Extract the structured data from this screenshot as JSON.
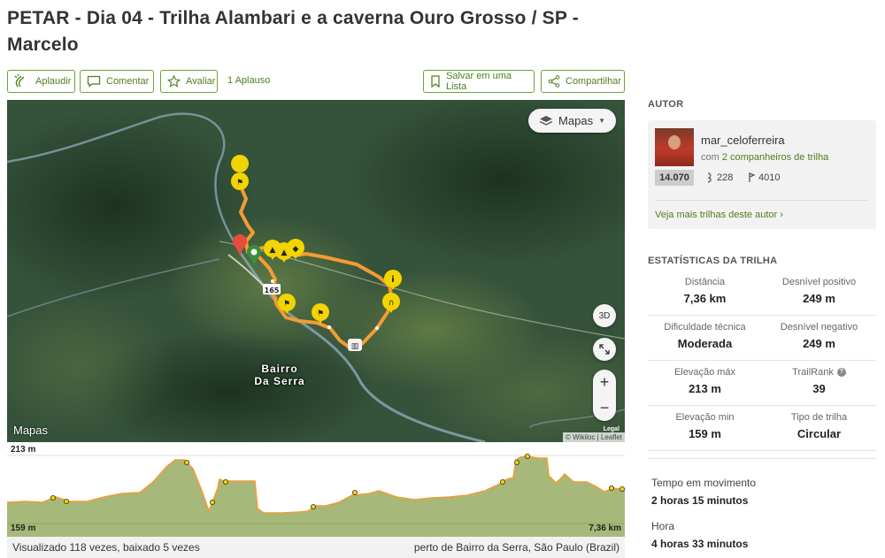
{
  "title": "PETAR - Dia 04 - Trilha Alambari e a caverna Ouro Grosso / SP - Marcelo",
  "actions": {
    "applaud": "Aplaudir",
    "comment": "Comentar",
    "rate": "Avaliar",
    "applause_count": "1 Aplauso",
    "save_list": "Salvar em uma Lista",
    "share": "Compartilhar"
  },
  "map": {
    "layer_button": "Mapas",
    "button_3d": "3D",
    "zoom_in": "+",
    "zoom_out": "−",
    "place_label_line1": "Bairro",
    "place_label_line2": "Da Serra",
    "route_badge": "165",
    "apple_maps": "Mapas",
    "legal": "Legal",
    "attribution": "© Wikiloc | Leaflet",
    "route_color": "#f39c33"
  },
  "elevation": {
    "max_label": "213 m",
    "min_label": "159 m",
    "distance_label": "7,36 km",
    "fill_color": "#9bb46a",
    "line_color": "#f39c33"
  },
  "footer": {
    "views": "Visualizado 118 vezes, baixado 5 vezes",
    "location": "perto de Bairro da Serra, São Paulo (Brazil)"
  },
  "author": {
    "heading": "AUTOR",
    "name": "mar_celoferreira",
    "companions_prefix": "com",
    "companions_link": "2 companheiros de trilha",
    "rank": "14.070",
    "followers": "228",
    "trails": "4010",
    "more_trails": "Veja mais trilhas deste autor ›"
  },
  "stats": {
    "heading": "ESTATÍSTICAS DA TRILHA",
    "rows": [
      [
        {
          "label": "Distância",
          "value": "7,36 km"
        },
        {
          "label": "Desnível positivo",
          "value": "249 m"
        }
      ],
      [
        {
          "label": "Dificuldade técnica",
          "value": "Moderada"
        },
        {
          "label": "Desnível negativo",
          "value": "249 m"
        }
      ],
      [
        {
          "label": "Elevação máx",
          "value": "213 m"
        },
        {
          "label": "TrailRank",
          "value": "39"
        }
      ],
      [
        {
          "label": "Elevação min",
          "value": "159 m"
        },
        {
          "label": "Tipo de trilha",
          "value": "Circular"
        }
      ]
    ],
    "moving_time_label": "Tempo em movimento",
    "moving_time_value": "2 horas 15 minutos",
    "total_time_label": "Hora",
    "total_time_value": "4 horas 33 minutos"
  }
}
